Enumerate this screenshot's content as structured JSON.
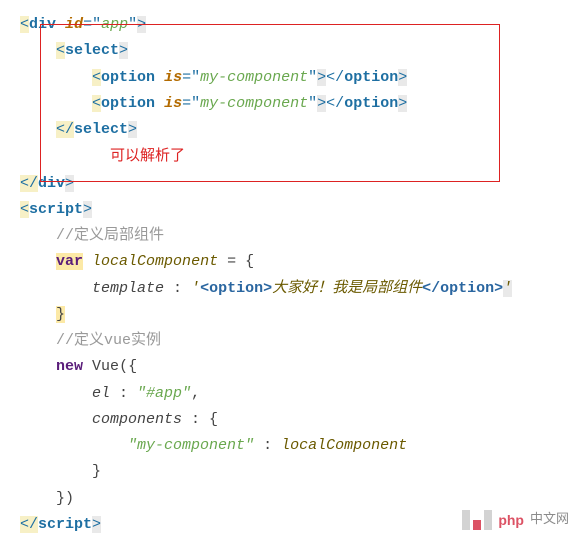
{
  "code": {
    "line1": {
      "lt": "<",
      "tag": "div",
      "attr": "id",
      "eq": "=",
      "q1": "\"",
      "val": "app",
      "q2": "\"",
      "gt": ">"
    },
    "line2": {
      "lt": "<",
      "tag": "select",
      "gt": ">"
    },
    "line3": {
      "lt": "<",
      "tag": "option",
      "attr": "is",
      "eq": "=",
      "q1": "\"",
      "val": "my-component",
      "q2": "\"",
      "gt": ">",
      "clt": "</",
      "ctag": "option",
      "cgt": ">"
    },
    "line4": {
      "lt": "<",
      "tag": "option",
      "attr": "is",
      "eq": "=",
      "q1": "\"",
      "val": "my-component",
      "q2": "\"",
      "gt": ">",
      "clt": "</",
      "ctag": "option",
      "cgt": ">"
    },
    "line5": {
      "clt": "</",
      "ctag": "select",
      "cgt": ">"
    },
    "annotation": "可以解析了",
    "line7": {
      "clt": "</",
      "ctag": "div",
      "cgt": ">"
    },
    "line8": {
      "lt": "<",
      "tag": "script",
      "gt": ">"
    },
    "line9": "//定义局部组件",
    "line10": {
      "kw": "var",
      "name": "localComponent",
      "rest": " = {"
    },
    "line11": {
      "prop": "template",
      "colon": " : ",
      "q": "'",
      "openLt": "<",
      "openTag": "option",
      "openGt": ">",
      "text": "大家好！我是局部组件",
      "closeLt": "</",
      "closeTag": "option",
      "closeGt": ">",
      "q2": "'"
    },
    "line12": "}",
    "line13": "//定义vue实例",
    "line14": {
      "kw": "new",
      "cls": "Vue",
      "rest": "({"
    },
    "line15": {
      "prop": "el",
      "colon": " : ",
      "val": "\"#app\"",
      "comma": ","
    },
    "line16": {
      "prop": "components",
      "colon": " : ",
      "rest": "{"
    },
    "line17": {
      "key": "\"my-component\"",
      "colon": " : ",
      "val": "localComponent"
    },
    "line18": "}",
    "line19": "})",
    "line20": {
      "clt": "</",
      "ctag": "script",
      "cgt": ">"
    }
  },
  "watermark": {
    "php": "php",
    "cn": "中文网"
  }
}
